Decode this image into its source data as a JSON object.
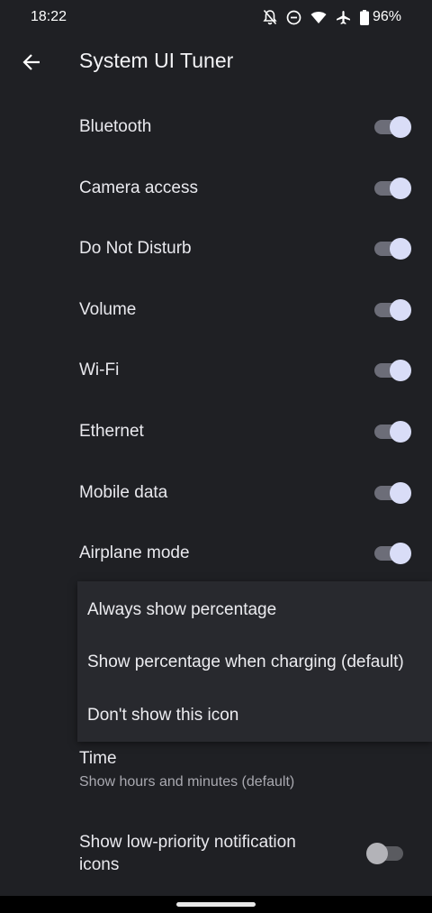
{
  "status_bar": {
    "time": "18:22",
    "battery": "96%",
    "icons": [
      "notifications-off-icon",
      "do-not-disturb-icon",
      "wifi-icon",
      "airplane-icon",
      "battery-icon"
    ]
  },
  "app_bar": {
    "title": "System UI Tuner",
    "back_icon": "arrow-back-icon"
  },
  "switches": [
    {
      "label": "Bluetooth",
      "on": true
    },
    {
      "label": "Camera access",
      "on": true
    },
    {
      "label": "Do Not Disturb",
      "on": true
    },
    {
      "label": "Volume",
      "on": true
    },
    {
      "label": "Wi-Fi",
      "on": true
    },
    {
      "label": "Ethernet",
      "on": true
    },
    {
      "label": "Mobile data",
      "on": true
    },
    {
      "label": "Airplane mode",
      "on": true
    }
  ],
  "battery_menu": {
    "options": [
      "Always show percentage",
      "Show percentage when charging (default)",
      "Don't show this icon"
    ]
  },
  "time_pref": {
    "title": "Time",
    "summary": "Show hours and minutes (default)"
  },
  "low_priority": {
    "label": "Show low-priority notification icons",
    "on": false
  },
  "colors": {
    "background": "#1f2024",
    "toggle_thumb_on": "#d9ddf7",
    "toggle_track_on": "#6c6d78",
    "menu_background": "#28292e"
  }
}
